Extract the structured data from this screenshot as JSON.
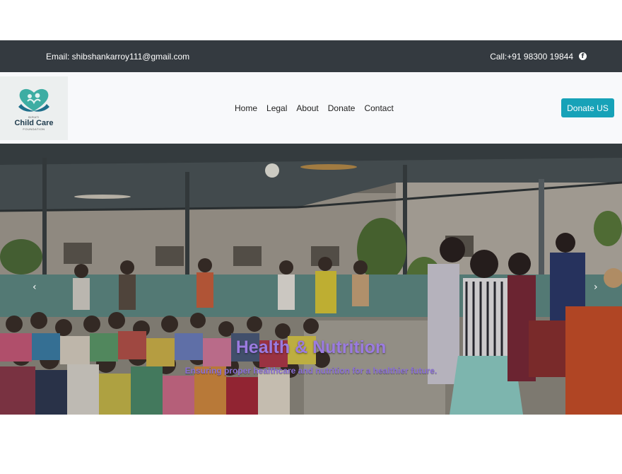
{
  "topbar": {
    "email": "Email: shibshankarroy111@gmail.com",
    "call": "Call:+91 98300 19844",
    "social_icon": "facebook-icon"
  },
  "logo": {
    "line1": "BIRATI",
    "line2": "Child Care",
    "line3": "FOUNDATION",
    "colors": {
      "heart": "#2aa59a",
      "hand": "#1f6f8b"
    }
  },
  "nav": {
    "items": [
      "Home",
      "Legal",
      "About",
      "Donate",
      "Contact"
    ],
    "donate_button": "Donate US"
  },
  "hero": {
    "title": "Health & Nutrition",
    "subtitle": "Ensuring proper healthcare and nutrition for a healthier future.",
    "prev_icon": "chevron-left-icon",
    "next_icon": "chevron-right-icon"
  },
  "colors": {
    "topbar_bg": "#343a40",
    "button_bg": "#17a2b8",
    "hero_title": "#9b7be0"
  }
}
